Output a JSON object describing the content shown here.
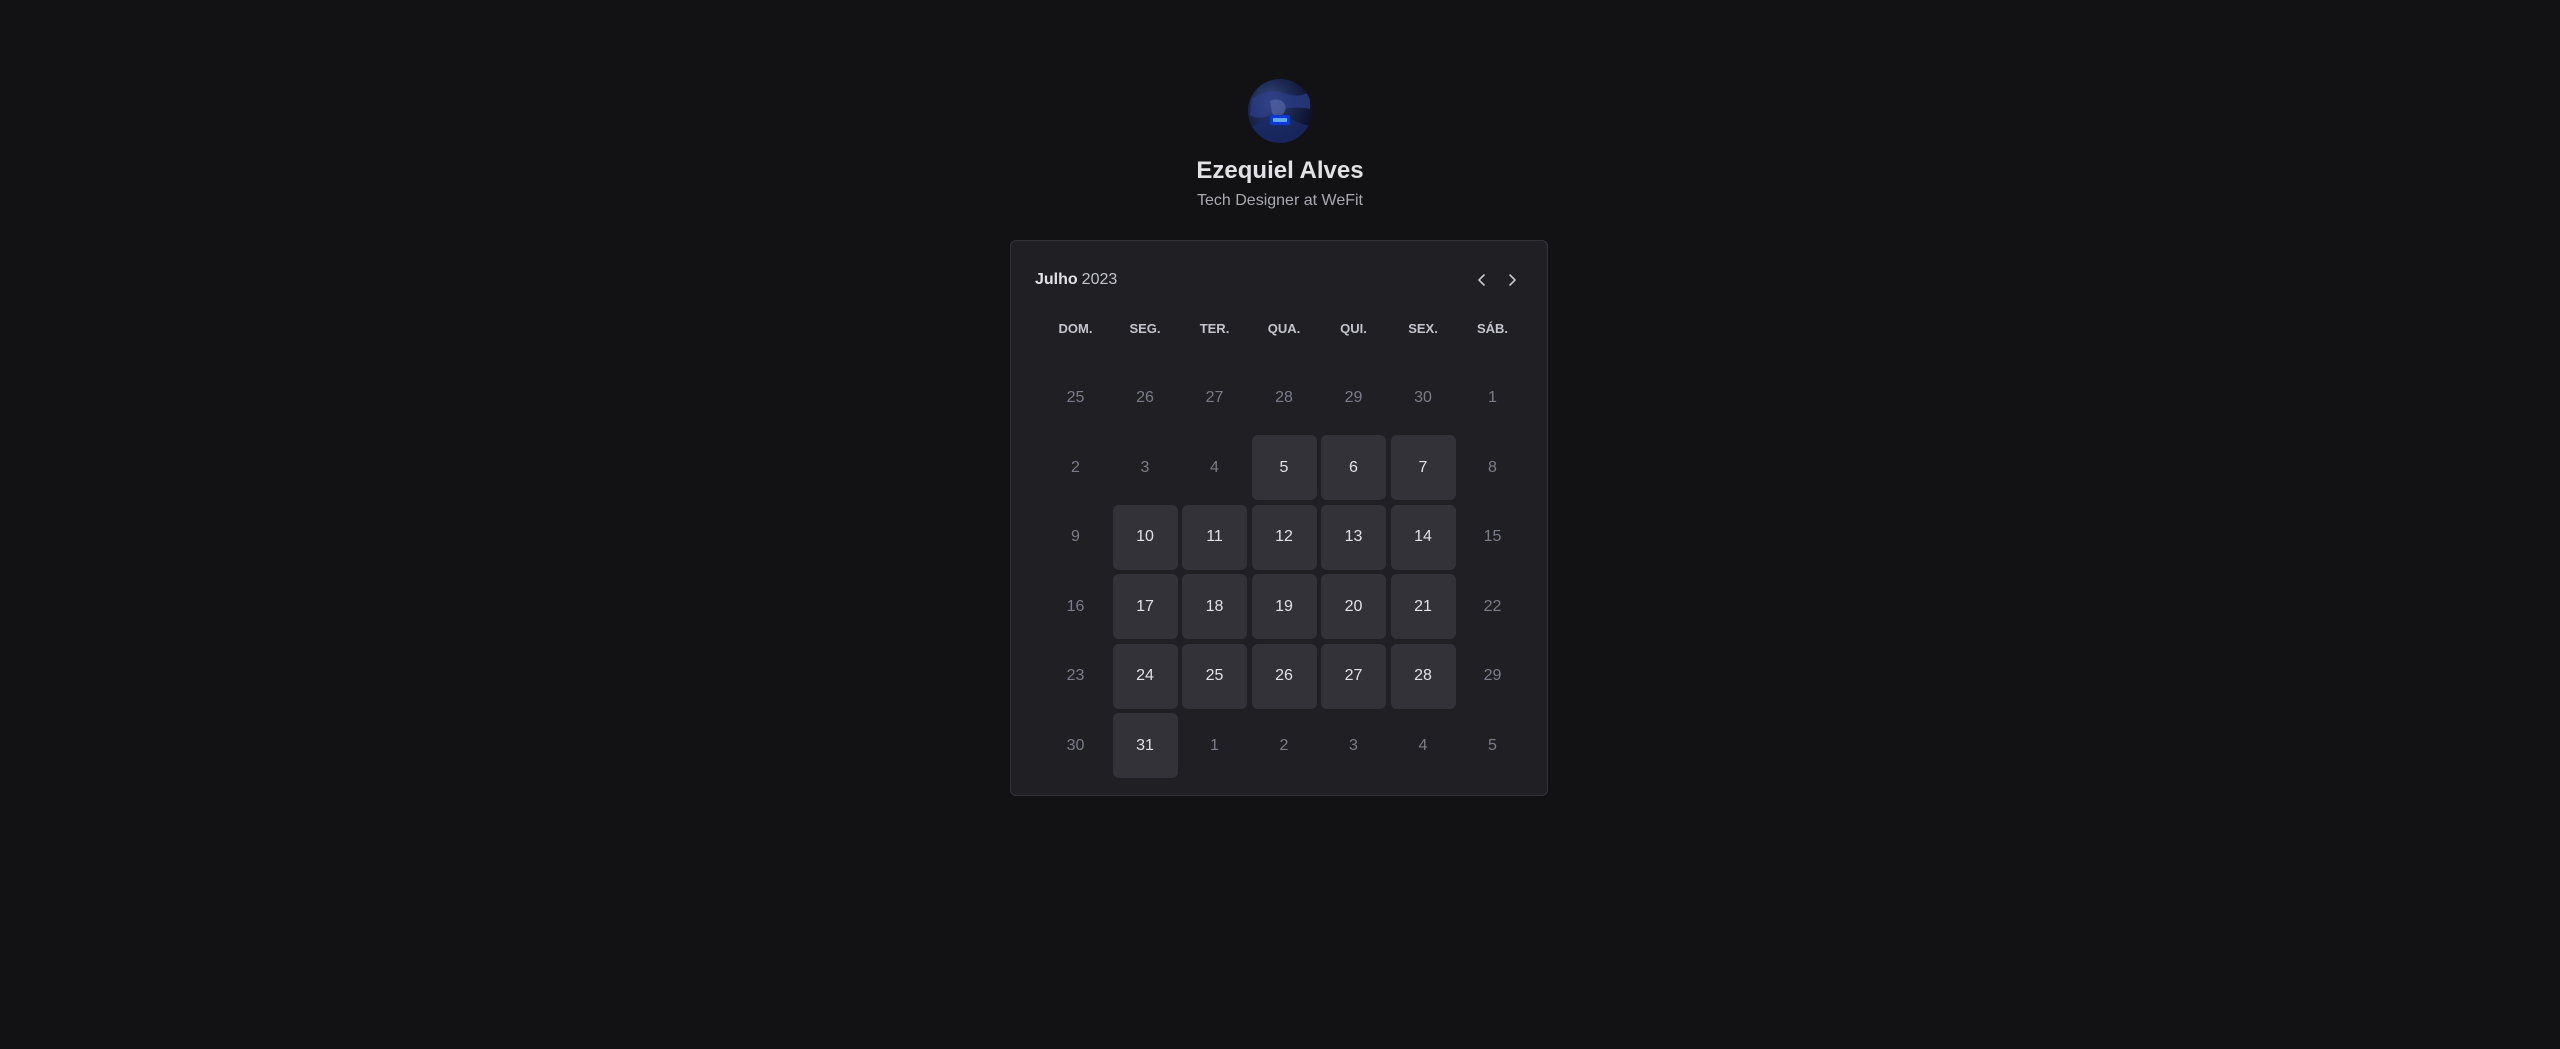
{
  "profile": {
    "avatar_icon": "profile-photo",
    "name": "Ezequiel Alves",
    "role": "Tech Designer at WeFit"
  },
  "calendar": {
    "month": "Julho",
    "year": "2023",
    "prev_icon": "chevron-left-icon",
    "next_icon": "chevron-right-icon",
    "weekdays": [
      "DOM.",
      "SEG.",
      "TER.",
      "QUA.",
      "QUI.",
      "SEX.",
      "SÁB."
    ],
    "weeks": [
      [
        {
          "d": "25",
          "available": false
        },
        {
          "d": "26",
          "available": false
        },
        {
          "d": "27",
          "available": false
        },
        {
          "d": "28",
          "available": false
        },
        {
          "d": "29",
          "available": false
        },
        {
          "d": "30",
          "available": false
        },
        {
          "d": "1",
          "available": false
        }
      ],
      [
        {
          "d": "2",
          "available": false
        },
        {
          "d": "3",
          "available": false
        },
        {
          "d": "4",
          "available": false
        },
        {
          "d": "5",
          "available": true
        },
        {
          "d": "6",
          "available": true
        },
        {
          "d": "7",
          "available": true
        },
        {
          "d": "8",
          "available": false
        }
      ],
      [
        {
          "d": "9",
          "available": false
        },
        {
          "d": "10",
          "available": true
        },
        {
          "d": "11",
          "available": true
        },
        {
          "d": "12",
          "available": true
        },
        {
          "d": "13",
          "available": true
        },
        {
          "d": "14",
          "available": true
        },
        {
          "d": "15",
          "available": false
        }
      ],
      [
        {
          "d": "16",
          "available": false
        },
        {
          "d": "17",
          "available": true
        },
        {
          "d": "18",
          "available": true
        },
        {
          "d": "19",
          "available": true
        },
        {
          "d": "20",
          "available": true
        },
        {
          "d": "21",
          "available": true
        },
        {
          "d": "22",
          "available": false
        }
      ],
      [
        {
          "d": "23",
          "available": false
        },
        {
          "d": "24",
          "available": true
        },
        {
          "d": "25",
          "available": true
        },
        {
          "d": "26",
          "available": true
        },
        {
          "d": "27",
          "available": true
        },
        {
          "d": "28",
          "available": true
        },
        {
          "d": "29",
          "available": false
        }
      ],
      [
        {
          "d": "30",
          "available": false
        },
        {
          "d": "31",
          "available": true
        },
        {
          "d": "1",
          "available": false
        },
        {
          "d": "2",
          "available": false
        },
        {
          "d": "3",
          "available": false
        },
        {
          "d": "4",
          "available": false
        },
        {
          "d": "5",
          "available": false
        }
      ]
    ]
  },
  "colors": {
    "background": "#121214",
    "card": "#202024",
    "available_day": "#323238",
    "muted_day": "#7c7c8a",
    "text": "#e1e1e6"
  }
}
